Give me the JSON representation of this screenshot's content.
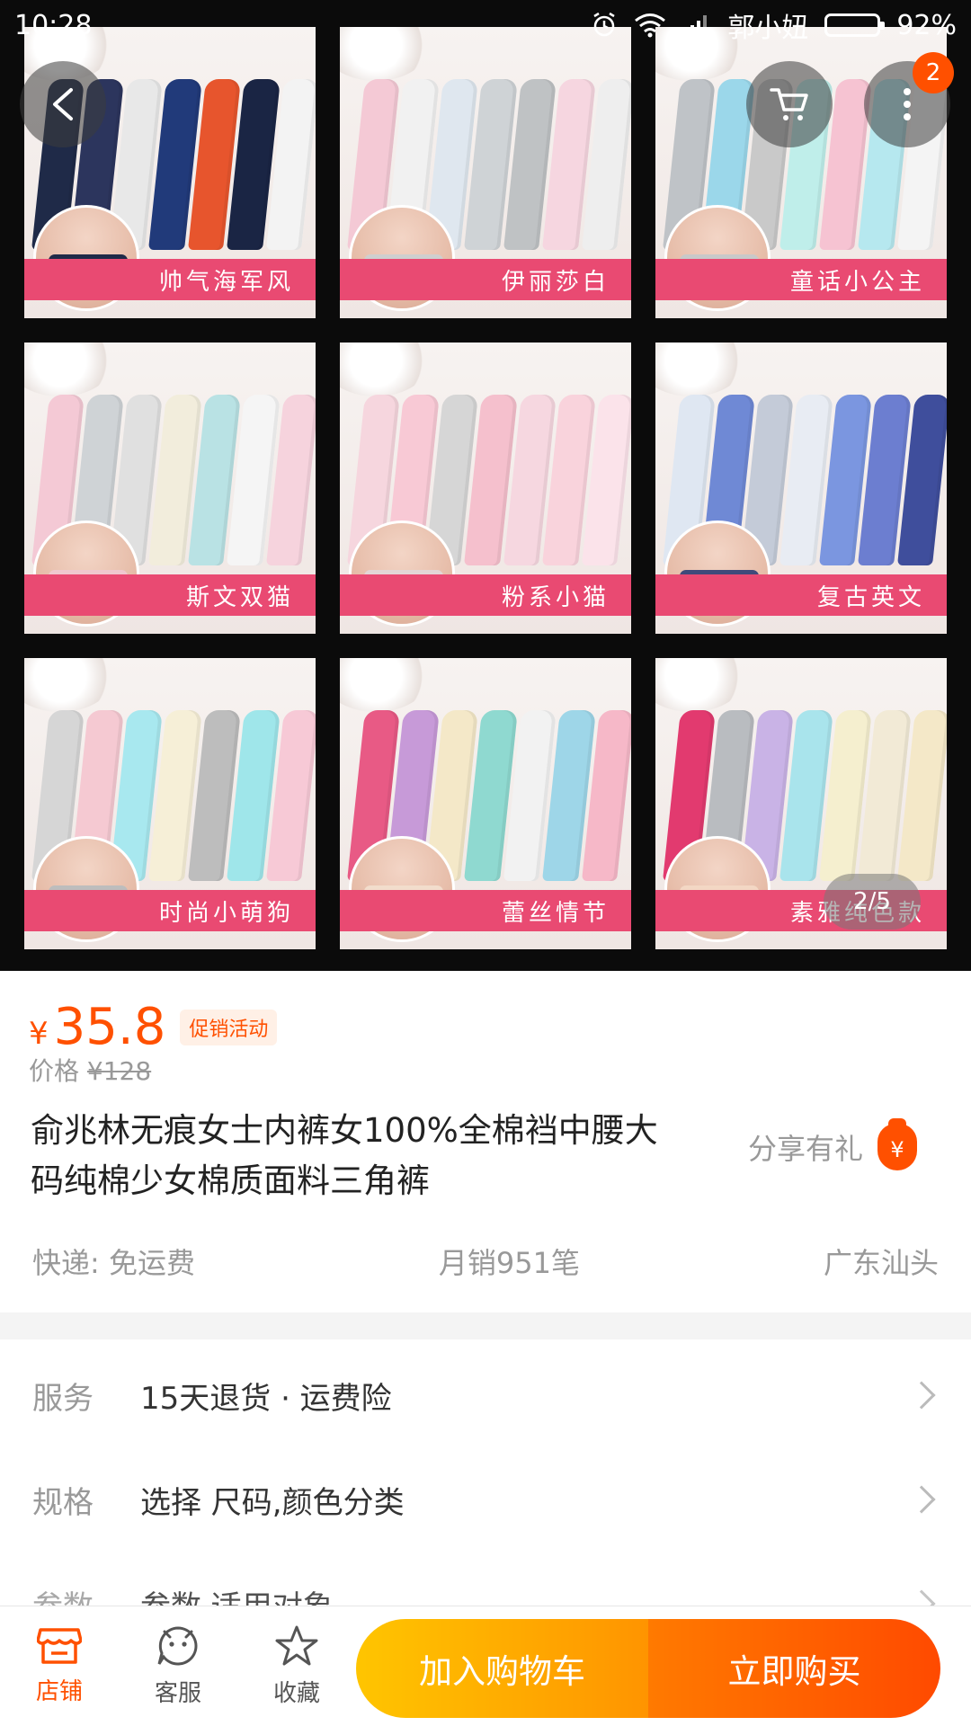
{
  "status_bar": {
    "time": "10:28",
    "carrier": "郭小妞",
    "battery_percent": "92%",
    "battery_level": 0.92,
    "icons": [
      "alarm-icon",
      "wifi-icon",
      "signal-icon",
      "battery-icon"
    ]
  },
  "gallery": {
    "page_indicator": "2/5",
    "cart_badge": "2",
    "tiles": [
      {
        "label": "帅气海军风",
        "colors": [
          "#1f2a48",
          "#2c355d",
          "#e8e8e8",
          "#213a7a",
          "#e7552d",
          "#1a2544",
          "#f3f3f3"
        ],
        "brief": "#1f2a48"
      },
      {
        "label": "伊丽莎白",
        "colors": [
          "#f4c9d5",
          "#f1f1f1",
          "#dfe7ef",
          "#cfd3d6",
          "#bfc2c4",
          "#f6d6e0",
          "#eeeeee"
        ],
        "brief": "#cfcfcf"
      },
      {
        "label": "童话小公主",
        "colors": [
          "#bfc3c7",
          "#9bd7ea",
          "#c9c9c9",
          "#bfeeea",
          "#f6c3d2",
          "#b6e8ef",
          "#f4f4f4"
        ],
        "brief": "#c9c9c9"
      },
      {
        "label": "斯文双猫",
        "colors": [
          "#f4c9d5",
          "#cfd3d6",
          "#e0e0e0",
          "#f2eddc",
          "#b9e2e4",
          "#f5f5f5",
          "#f6d3dd"
        ],
        "brief": "#f0c8cf"
      },
      {
        "label": "粉系小猫",
        "colors": [
          "#f6d6de",
          "#f8c9d5",
          "#d6d6d6",
          "#f5c0cd",
          "#f6d7e0",
          "#f9d3dc",
          "#fbe3ea"
        ],
        "brief": "#e3d6d6"
      },
      {
        "label": "复古英文",
        "colors": [
          "#dfe7f2",
          "#6f89d5",
          "#c4cbd8",
          "#e8ecf3",
          "#7b96e0",
          "#6c7ed0",
          "#3f4e9c"
        ],
        "brief": "#3f4a7a"
      },
      {
        "label": "时尚小萌狗",
        "colors": [
          "#d6d6d6",
          "#f5c9d2",
          "#a8e8ef",
          "#f6efd7",
          "#bdbdbd",
          "#9fe6ea",
          "#f7c9d6"
        ],
        "brief": "#bdbdbd"
      },
      {
        "label": "蕾丝情节",
        "colors": [
          "#e85a85",
          "#c79ad8",
          "#f4e8c8",
          "#8fd9d0",
          "#f2f2f2",
          "#9ed6e8",
          "#f6b8c8"
        ],
        "brief": "#f2ddcc"
      },
      {
        "label": "素雅纯色款",
        "colors": [
          "#e23a6f",
          "#b9bcc0",
          "#c9b3e6",
          "#a9e4ec",
          "#f5efcf",
          "#f2ead6",
          "#f4e8c8"
        ],
        "brief": "#f3d7c4"
      }
    ]
  },
  "product": {
    "currency": "¥",
    "price": "35.8",
    "promo_label": "促销活动",
    "original_price_label": "价格",
    "original_price": "¥128",
    "title": "俞兆林无痕女士内裤女100%全棉裆中腰大码纯棉少女棉质面料三角裤",
    "share_label": "分享有礼",
    "share_icon_glyph": "¥",
    "shipping": "快递: 免运费",
    "monthly_sales": "月销951笔",
    "location": "广东汕头"
  },
  "options": {
    "service_label": "服务",
    "service_value": "15天退货 · 运费险",
    "spec_label": "规格",
    "spec_value": "选择 尺码,颜色分类",
    "params_label": "参数",
    "params_value": "参数,适用对象"
  },
  "bottom_bar": {
    "store_label": "店铺",
    "service_label": "客服",
    "favorite_label": "收藏",
    "add_to_cart": "加入购物车",
    "buy_now": "立即购买"
  },
  "colors": {
    "accent": "#ff5000",
    "cart_gradient": [
      "#ffc500",
      "#ff9400"
    ],
    "buy_gradient": [
      "#ff7a00",
      "#ff4a00"
    ],
    "banner_pink": "#e94a72"
  }
}
